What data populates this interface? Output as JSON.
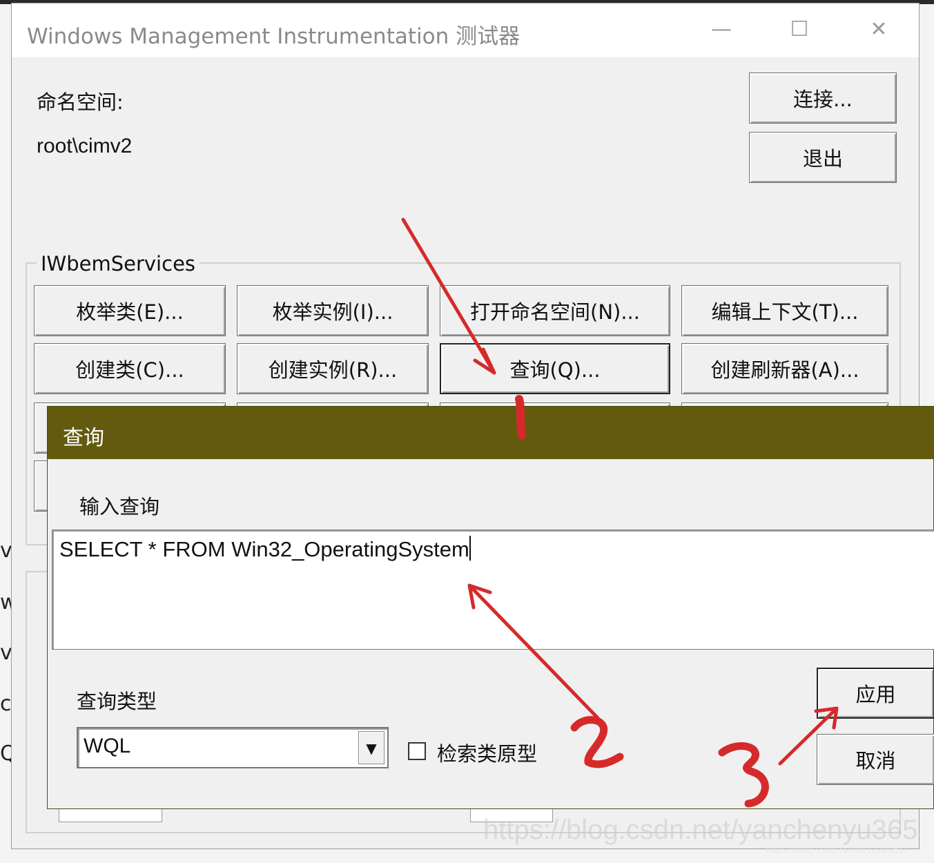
{
  "main_window": {
    "title": "Windows Management Instrumentation 测试器",
    "controls": {
      "minimize": "—",
      "maximize": "☐",
      "close": "✕"
    },
    "namespace_label": "命名空间:",
    "namespace_value": "root\\cimv2",
    "connect_button": "连接...",
    "exit_button": "退出",
    "group_label": "IWbemServices",
    "service_buttons": [
      "枚举类(E)...",
      "枚举实例(I)...",
      "打开命名空间(N)...",
      "编辑上下文(T)...",
      "创建类(C)...",
      "创建实例(R)...",
      "查询(Q)...",
      "创建刷新器(A)..."
    ]
  },
  "query_dialog": {
    "title": "查询",
    "input_label": "输入查询",
    "query_text": "SELECT * FROM Win32_OperatingSystem",
    "query_type_label": "查询类型",
    "query_type_value": "WQL",
    "retrieve_prototype_label": "检索类原型",
    "retrieve_prototype_checked": false,
    "apply_button": "应用",
    "cancel_button": "取消"
  },
  "annotations": {
    "color": "#d62a2a",
    "step_labels": [
      "1",
      "2",
      "3"
    ]
  },
  "watermark": {
    "main": "https://blog.csdn.net/yanchenyu365",
    "small": "https://blog.csdn.net/u012209617"
  },
  "background_fragments": [
    "vi",
    "w",
    "v",
    "ce",
    "Q"
  ]
}
